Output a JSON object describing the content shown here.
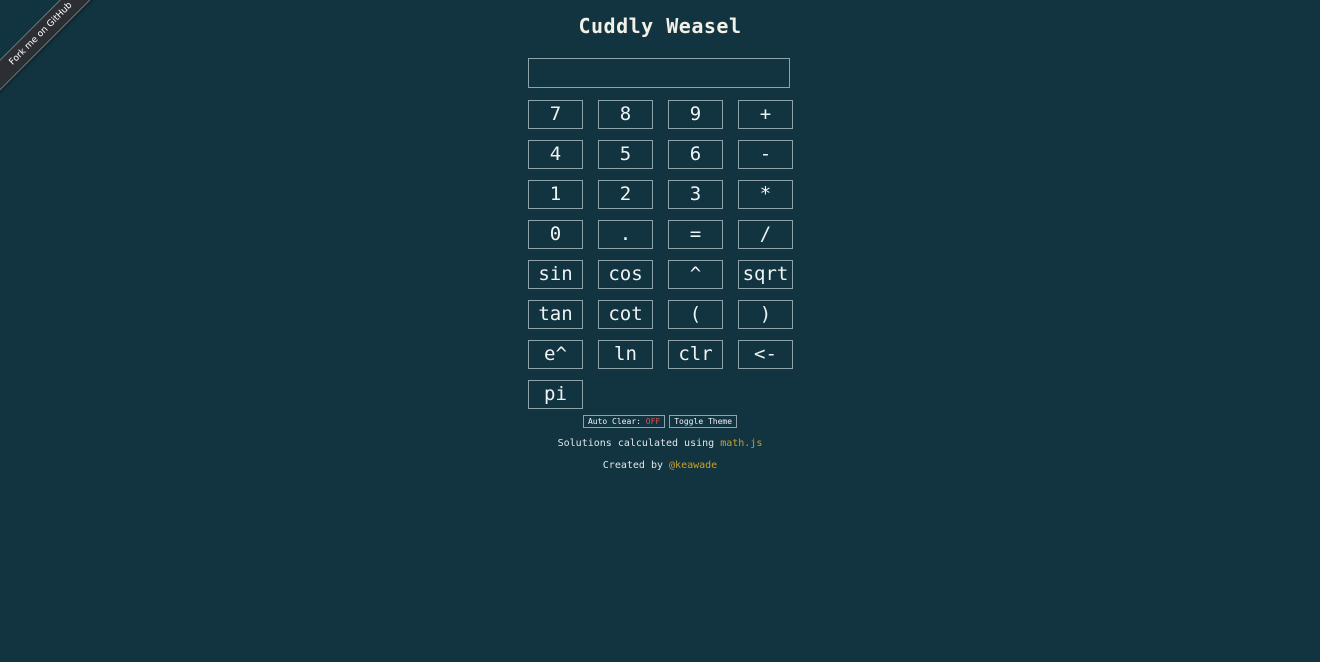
{
  "ribbon": {
    "label": "Fork me on GitHub"
  },
  "header": {
    "title": "Cuddly Weasel"
  },
  "display": {
    "value": ""
  },
  "keys": [
    "7",
    "8",
    "9",
    "+",
    "4",
    "5",
    "6",
    "-",
    "1",
    "2",
    "3",
    "*",
    "0",
    ".",
    "=",
    "/",
    "sin",
    "cos",
    "^",
    "sqrt",
    "tan",
    "cot",
    "(",
    ")",
    "e^",
    "ln",
    "clr",
    "<-",
    "pi"
  ],
  "controls": {
    "auto_clear_label": "Auto Clear:",
    "auto_clear_state": "OFF",
    "toggle_theme_label": "Toggle Theme"
  },
  "footer": {
    "solutions_text": "Solutions calculated using",
    "solutions_link": "math.js",
    "created_text": "Created by",
    "created_link": "@keawade"
  },
  "colors": {
    "background": "#123440",
    "border": "#8ea3aa",
    "link": "#c9a227",
    "off": "#d9534f"
  }
}
